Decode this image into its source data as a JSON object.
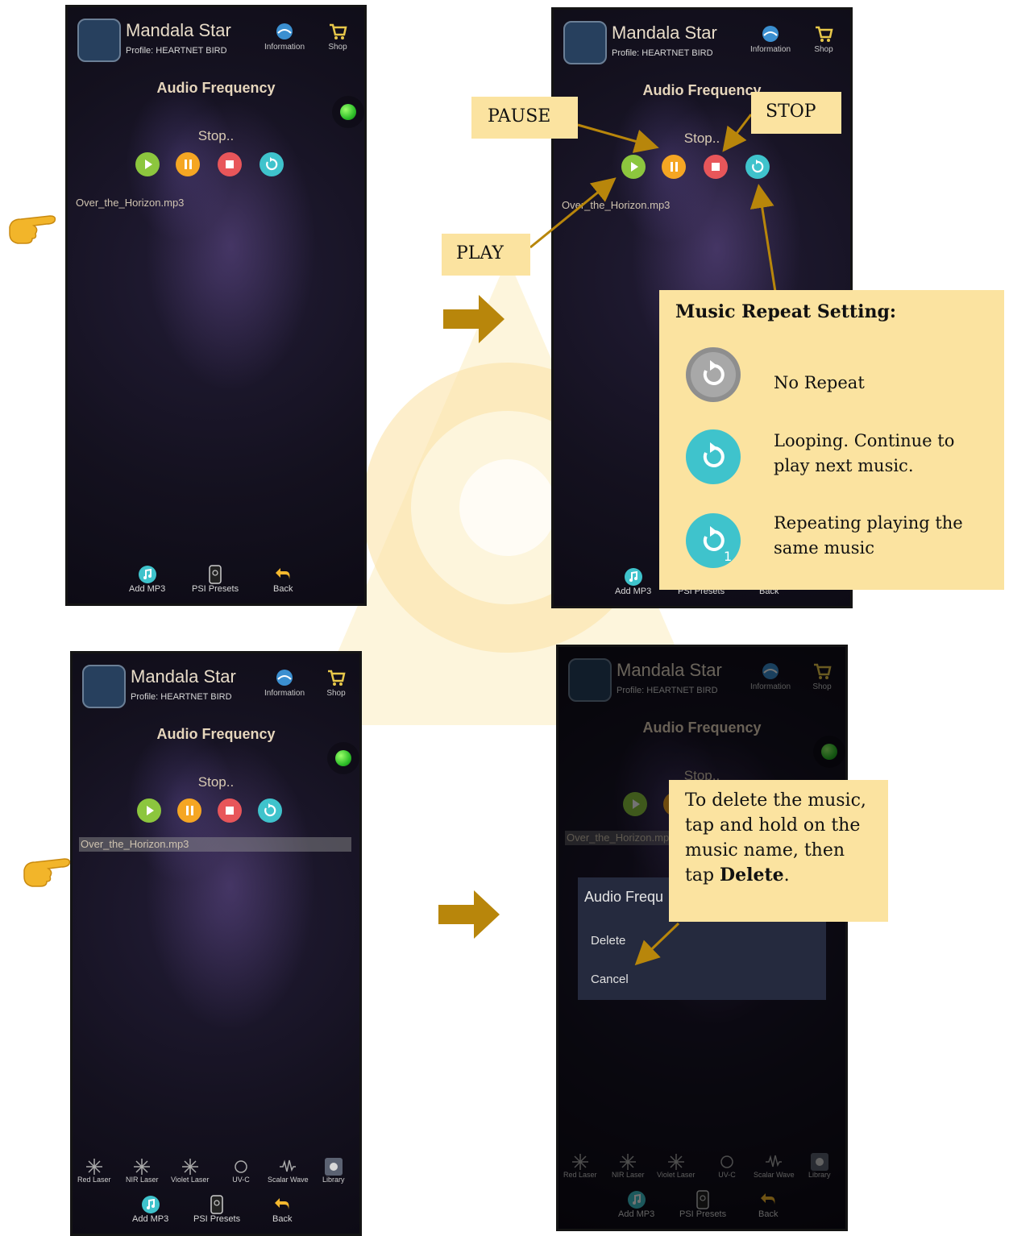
{
  "app": {
    "name": "Mandala Star",
    "profile": "Profile: HEARTNET BIRD",
    "info_label": "Information",
    "shop_label": "Shop"
  },
  "screen": {
    "section_title": "Audio Frequency",
    "status_text": "Stop..",
    "track_name": "Over_the_Horizon.mp3",
    "status_led_color": "#2fbf2a"
  },
  "controls": {
    "play_color": "#8cc63e",
    "pause_color": "#f5a623",
    "stop_color": "#e8565a",
    "repeat_color": "#3fc3cc"
  },
  "bottom_nav": {
    "add_mp3": "Add MP3",
    "psi_presets": "PSI Presets",
    "back": "Back"
  },
  "library_row": {
    "red_laser": "Red Laser",
    "nir_laser": "NIR Laser",
    "violet_laser": "Violet Laser",
    "uvc": "UV-C",
    "scalar_wave": "Scalar Wave",
    "library": "Library"
  },
  "dialog": {
    "title": "Audio Frequ",
    "delete": "Delete",
    "cancel": "Cancel"
  },
  "callouts": {
    "pause": "PAUSE",
    "stop": "STOP",
    "play": "PLAY",
    "repeat_title": "Music Repeat Setting:",
    "no_repeat": "No Repeat",
    "looping": "Looping. Continue to play next music.",
    "repeat_same": "Repeating playing the same music",
    "repeat_badge": "1",
    "delete_hint_before": "To delete the music, tap and hold on the music name, then tap ",
    "delete_hint_bold": "Delete",
    "delete_hint_after": "."
  },
  "colors": {
    "callout_bg": "#fbe3a0",
    "arrow": "#b8860b"
  }
}
